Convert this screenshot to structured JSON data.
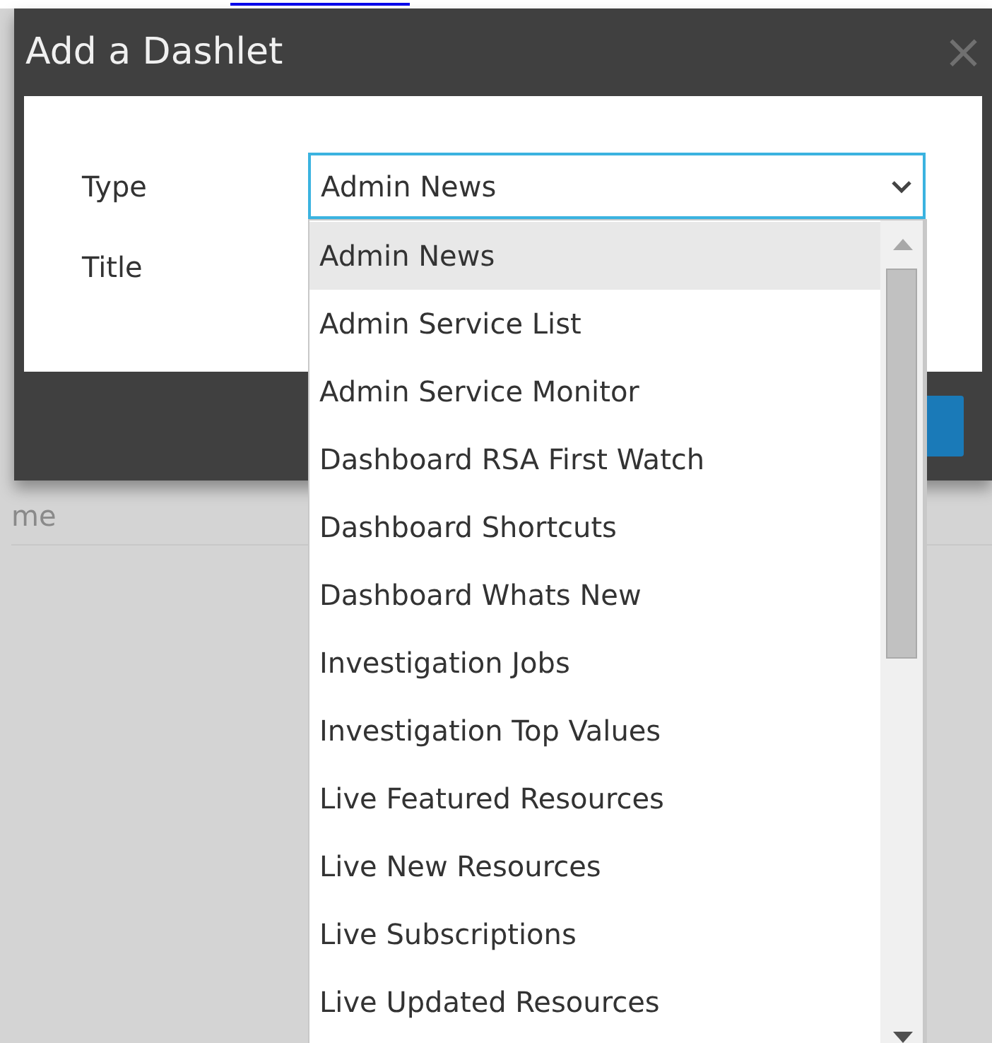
{
  "dialog": {
    "title": "Add a Dashlet",
    "close": "×",
    "fields": [
      {
        "label": "Type",
        "kind": "select",
        "value": "Admin News"
      },
      {
        "label": "Title",
        "kind": "text"
      }
    ]
  },
  "dropdown": {
    "options": [
      {
        "label": "Admin News",
        "selected": true
      },
      {
        "label": "Admin Service List",
        "selected": false
      },
      {
        "label": "Admin Service Monitor",
        "selected": false
      },
      {
        "label": "Dashboard RSA First Watch",
        "selected": false
      },
      {
        "label": "Dashboard Shortcuts",
        "selected": false
      },
      {
        "label": "Dashboard Whats New",
        "selected": false
      },
      {
        "label": "Investigation Jobs",
        "selected": false
      },
      {
        "label": "Investigation Top Values",
        "selected": false
      },
      {
        "label": "Live Featured Resources",
        "selected": false
      },
      {
        "label": "Live New Resources",
        "selected": false
      },
      {
        "label": "Live Subscriptions",
        "selected": false
      },
      {
        "label": "Live Updated Resources",
        "selected": false
      }
    ]
  },
  "background_label": "me"
}
